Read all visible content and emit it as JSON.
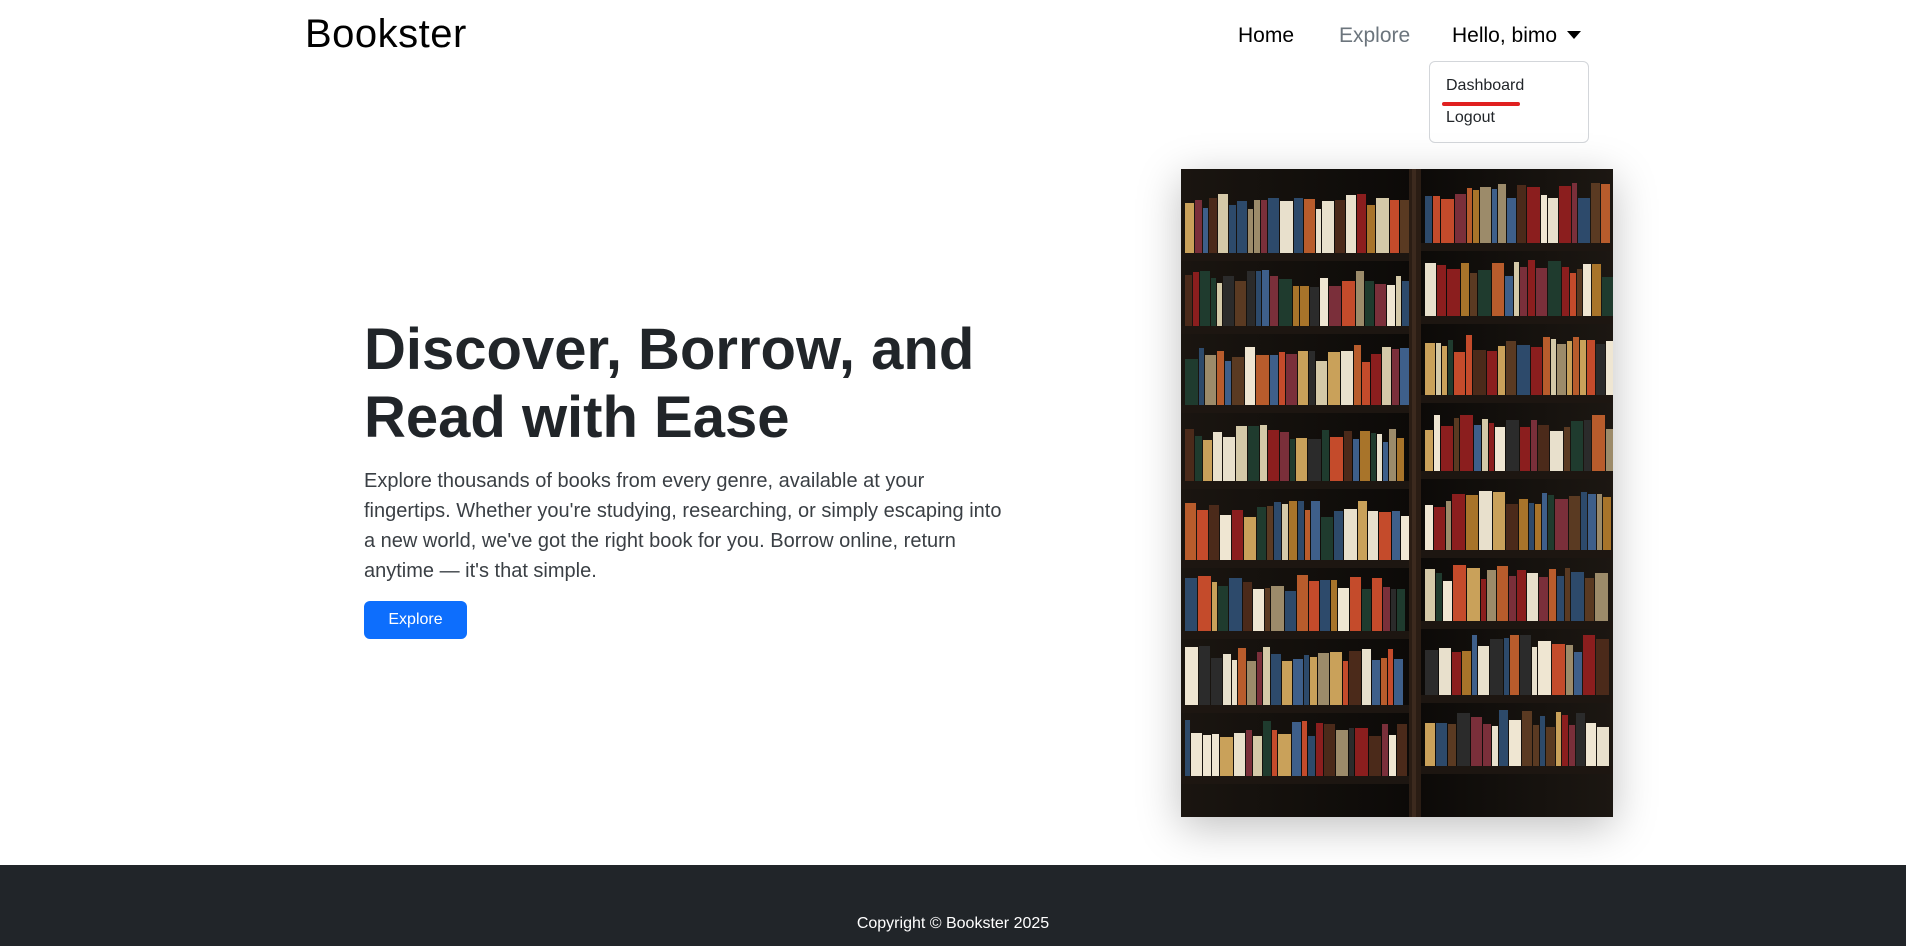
{
  "navbar": {
    "brand": "Bookster",
    "links": {
      "home": "Home",
      "explore": "Explore",
      "user": "Hello, bimo"
    }
  },
  "dropdown": {
    "items": [
      "Dashboard",
      "Logout"
    ]
  },
  "hero": {
    "title": "Discover, Borrow, and Read with Ease",
    "description": "Explore thousands of books from every genre, available at your fingertips. Whether you're studying, researching, or simply escaping into a new world, we've got the right book for you. Borrow online, return anytime — it's that simple.",
    "button": "Explore",
    "image": "bookshelf-photo"
  },
  "footer": {
    "copyright": "Copyright © Bookster 2025"
  },
  "colors": {
    "primary": "#0d6efd",
    "footer_bg": "#212529",
    "annotation": "#e02020"
  }
}
